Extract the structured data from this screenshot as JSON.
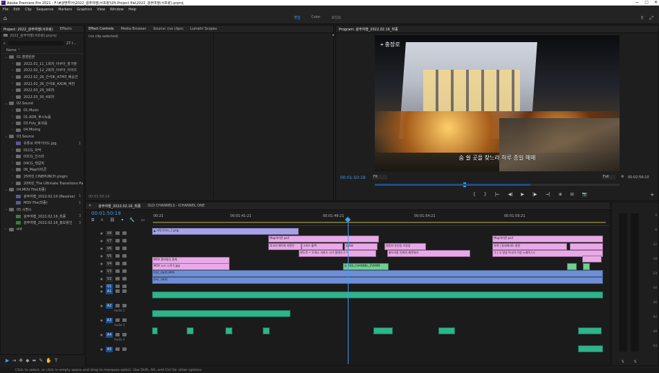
{
  "window": {
    "title": "Adobe Premiere Pro 2021 - F:\\#광명투어\\2022_광주여행(서프랑)\\05.Project file\\2022_광주여행(서프랑).prproj",
    "app_icon": "Pr",
    "controls": [
      "—",
      "▢",
      "✕"
    ]
  },
  "menu": [
    "File",
    "Edit",
    "Clip",
    "Sequence",
    "Markers",
    "Graphics",
    "View",
    "Window",
    "Help"
  ],
  "workspace": {
    "tabs": [
      "편집",
      "Color",
      "오디오"
    ],
    "active": "편집"
  },
  "project": {
    "tabs": [
      "Project: 2022_광주여행(서프랑)",
      "Effects"
    ],
    "file": "2022_광주여행(서프랑).prproj",
    "item_count": "27 I...",
    "column": "Name",
    "rows": [
      {
        "label": "01.촬영원본",
        "type": "folder",
        "indent": 0,
        "open": true
      },
      {
        "label": "2022.01_11_1회차_아쿠아_장가영",
        "type": "folder",
        "indent": 1
      },
      {
        "label": "2022.02_12_2회차_아쿠아_이아즈",
        "type": "folder",
        "indent": 1
      },
      {
        "label": "2022.02_26_간석로_A7M3_배승건",
        "type": "folder",
        "indent": 1
      },
      {
        "label": "2022.02_26_간석로_AXON_박찬",
        "type": "folder",
        "indent": 1
      },
      {
        "label": "2022.03_29_3회차",
        "type": "folder",
        "indent": 1
      },
      {
        "label": "2022.03_30_4회차",
        "type": "folder",
        "indent": 1
      },
      {
        "label": "02.Sound",
        "type": "folder",
        "indent": 0,
        "open": true
      },
      {
        "label": "01.Music",
        "type": "folder",
        "indent": 1
      },
      {
        "label": "01.ADR_후시녹음",
        "type": "folder",
        "indent": 1
      },
      {
        "label": "03.Foly_효과음",
        "type": "folder",
        "indent": 1
      },
      {
        "label": "04.Mixing",
        "type": "folder",
        "indent": 1
      },
      {
        "label": "03.Source",
        "type": "folder",
        "indent": 0,
        "open": true
      },
      {
        "label": "유튜브 자막가이드.jpg",
        "type": "file",
        "indent": 1,
        "count": "1"
      },
      {
        "label": "01CG_자막",
        "type": "folder",
        "indent": 1
      },
      {
        "label": "03CG_인스타",
        "type": "folder",
        "indent": 1
      },
      {
        "label": "04CG_책갈피",
        "type": "folder",
        "indent": 1
      },
      {
        "label": "06_Map이미콘",
        "type": "folder",
        "indent": 1
      },
      {
        "label": "25버킷 CINEPUNCH plugin",
        "type": "folder",
        "indent": 1
      },
      {
        "label": "20버킷_The Ultimate Transitions Pa",
        "type": "folder",
        "indent": 1
      },
      {
        "label": "04.MOV File(최종)",
        "type": "folder",
        "indent": 0,
        "open": true
      },
      {
        "label": "광주여행_2022.02.10 (Resolve)",
        "type": "file",
        "indent": 1,
        "count": "1"
      },
      {
        "label": "MOV File(최종)",
        "type": "file",
        "indent": 1,
        "count": "1"
      },
      {
        "label": "05.시퀀스",
        "type": "folder",
        "indent": 0,
        "open": true
      },
      {
        "label": "광주여행_2022.02.16_최종",
        "type": "seq",
        "indent": 1,
        "count": "3"
      },
      {
        "label": "광주여행_2022.02.16_홍보용인",
        "type": "seq",
        "indent": 1,
        "count": "3"
      },
      {
        "label": "old",
        "type": "folder",
        "indent": 0
      }
    ]
  },
  "effect_controls": {
    "tabs": [
      "Effect Controls",
      "Media Browser",
      "Source: (no clips)",
      "Lumetri Scopes"
    ],
    "empty_label": "(no clip selected)",
    "timecode": "00:01:50:19"
  },
  "program": {
    "tab": "Program: 광주여행_2022.02.16_최종",
    "location_badge": "충장로",
    "subtitle": "숨 쉴 곳을 찾느라 하루 종일 헤매",
    "timecode": "00:01:50:19",
    "fit": "Fit",
    "quality": "Full",
    "duration": "00:02:59:10",
    "transport": [
      "{",
      "}",
      "|←",
      "◀|",
      "▶",
      "|▶",
      "→|",
      "⊕",
      "⊟",
      "📷"
    ]
  },
  "timeline": {
    "tabs": [
      "광주여행_2022.02.16_최종",
      "OLD CHANNELS - ICHANNEL ONE"
    ],
    "timecode": "00:01:50:19",
    "ruler": [
      "00:01:41:21",
      "00:01:49:21",
      "00:01:54:21",
      "00:01:59:21"
    ],
    "video_tracks": [
      "V8",
      "V7",
      "V6",
      "V5",
      "V4",
      "V3",
      "V2",
      "V1"
    ],
    "audio_tracks": [
      "A1",
      "A2",
      "A3",
      "A4",
      "A5"
    ],
    "audio_names": [
      "Audio 2",
      "Audio 3",
      "Audio 4"
    ],
    "clip_labels": {
      "v8": "▲ 자막가이드_1.png",
      "v7a": "Map아이콘.psd",
      "v7b": "Map아이콘.psd",
      "v6a": "자고리 헤이마 지렛진",
      "v6b": "그리드 블랙",
      "v6c": "동의표",
      "v6d": "명동한 동인동 이동장",
      "v6e": "충도비장 인위의 제작대리",
      "v6f": "하며 | 동네에서도 총장",
      "v5a": "현도로 ~ 도미노 서비스 시기 중대기 2 이",
      "v5b": "그 | 고 방송 아시아 가상 노래의 (시",
      "v4a": "MOV 홍보영상 중재",
      "v3a": "MOV 노스 시 8 1.jpg",
      "v3b": "숨 ADS_CHANNEL_ZVAMM",
      "v2a": "DSC_0845.MP4",
      "v2b": "DSC_1212.MP4",
      "v2c": "DSC_1301.MP4",
      "v1a": "DSC_0845",
      "v1b": "DSC_1212.MP4",
      "v1c": "DSC_1311.MP4"
    }
  },
  "meters": {
    "ticks": [
      "0",
      "-6",
      "-12",
      "-18",
      "-24",
      "-30",
      "-36",
      "-42",
      "-48",
      "-54"
    ],
    "labels": [
      "S",
      "S"
    ]
  },
  "tools": [
    "▶",
    "⇥",
    "✥",
    "◆",
    "⬌",
    "✎",
    "✋",
    "T"
  ],
  "status": "Click to select, or click in empty space and drag to marquee select. Use Shift, Alt, and Ctrl for other options."
}
